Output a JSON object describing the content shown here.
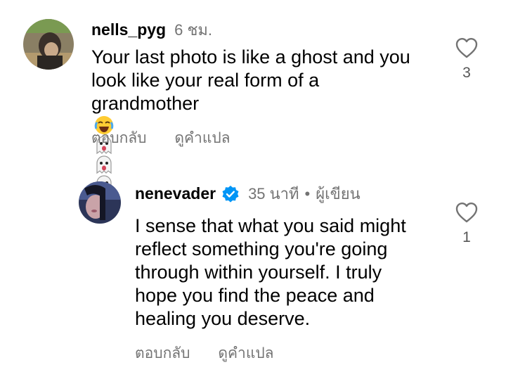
{
  "comments": [
    {
      "username": "nells_pyg",
      "time": "6 ชม.",
      "author_tag": "",
      "lines": [
        "Your last photo is like a ghost and you",
        "look like your real form of a",
        "grandmother"
      ],
      "emojis": [
        "face-with-tears-of-joy",
        "ghost",
        "ghost",
        "ghost",
        "older-person"
      ],
      "like_count": "3",
      "reply_label": "ตอบกลับ",
      "translate_label": "ดูคำแปล"
    },
    {
      "username": "nenevader",
      "verified": true,
      "time": "35 นาที",
      "author_tag": "ผู้เขียน",
      "lines": [
        "I sense that what you said might",
        "reflect something you're going",
        "through within yourself. I truly",
        "hope you find the peace and",
        "healing you deserve."
      ],
      "like_count": "1",
      "reply_label": "ตอบกลับ",
      "translate_label": "ดูคำแปล"
    }
  ],
  "colors": {
    "text": "#000000",
    "secondary": "#737373",
    "verified": "#0095f6"
  },
  "icons": {
    "like": "heart-outline-icon",
    "verified": "verified-badge-icon"
  }
}
